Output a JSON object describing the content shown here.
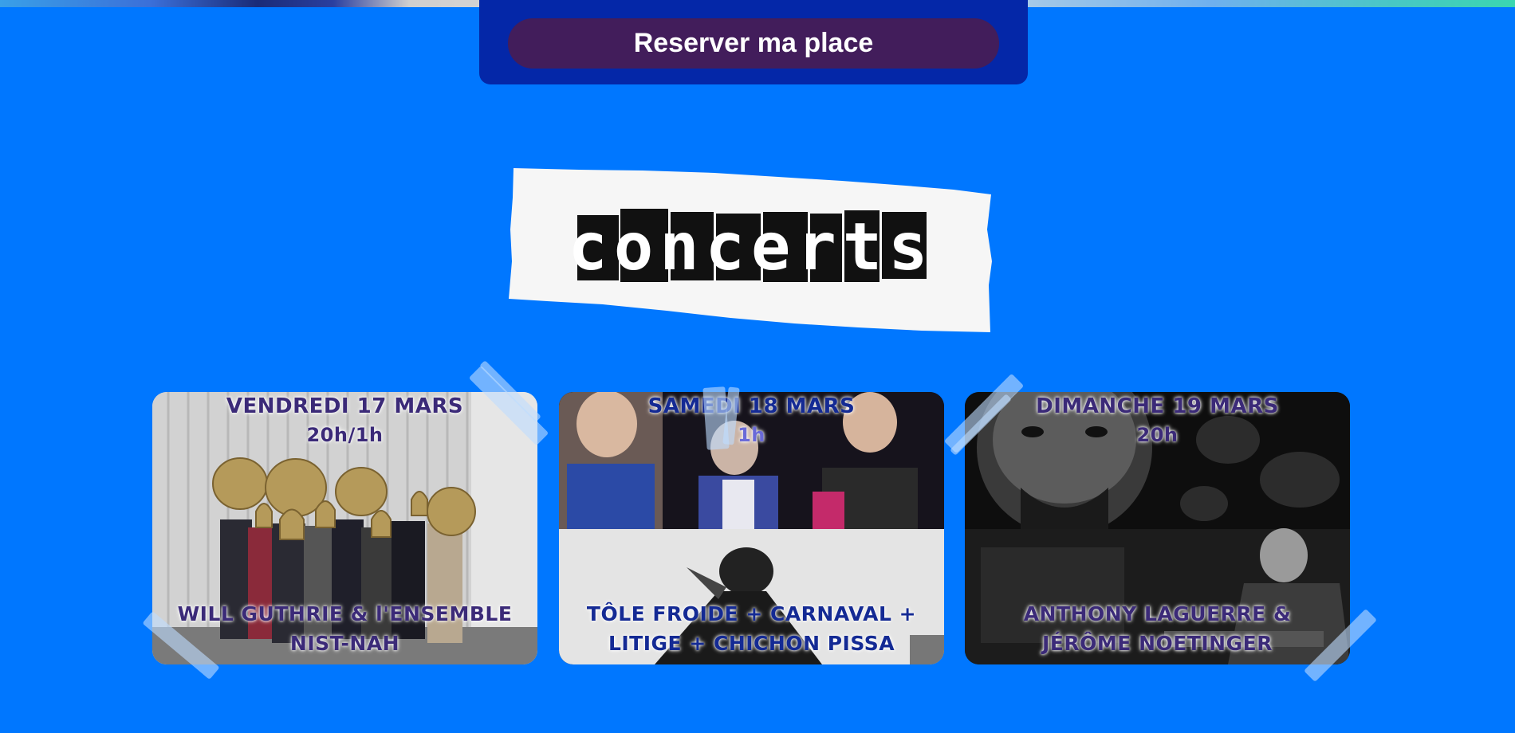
{
  "reserve": {
    "label": "Reserver ma place"
  },
  "concerts_banner": {
    "text": "concerts"
  },
  "concerts": [
    {
      "date": "VENDREDI 17 MARS",
      "time": "20h/1h",
      "title": "WILL GUTHRIE & l'ENSEMBLE NIST-NAH"
    },
    {
      "date": "SAMEDI 18 MARS",
      "time": "1h",
      "title": "TÔLE FROIDE + CARNAVAL + LITIGE + CHICHON PISSA"
    },
    {
      "date": "DIMANCHE 19 MARS",
      "time": "20h",
      "title": "ANTHONY LAGUERRE & JÉRÔME NOETINGER"
    }
  ],
  "colors": {
    "background": "#0077ff",
    "panel": "#0427a8",
    "button": "#421d5b",
    "card_text": "#3b2a78"
  }
}
